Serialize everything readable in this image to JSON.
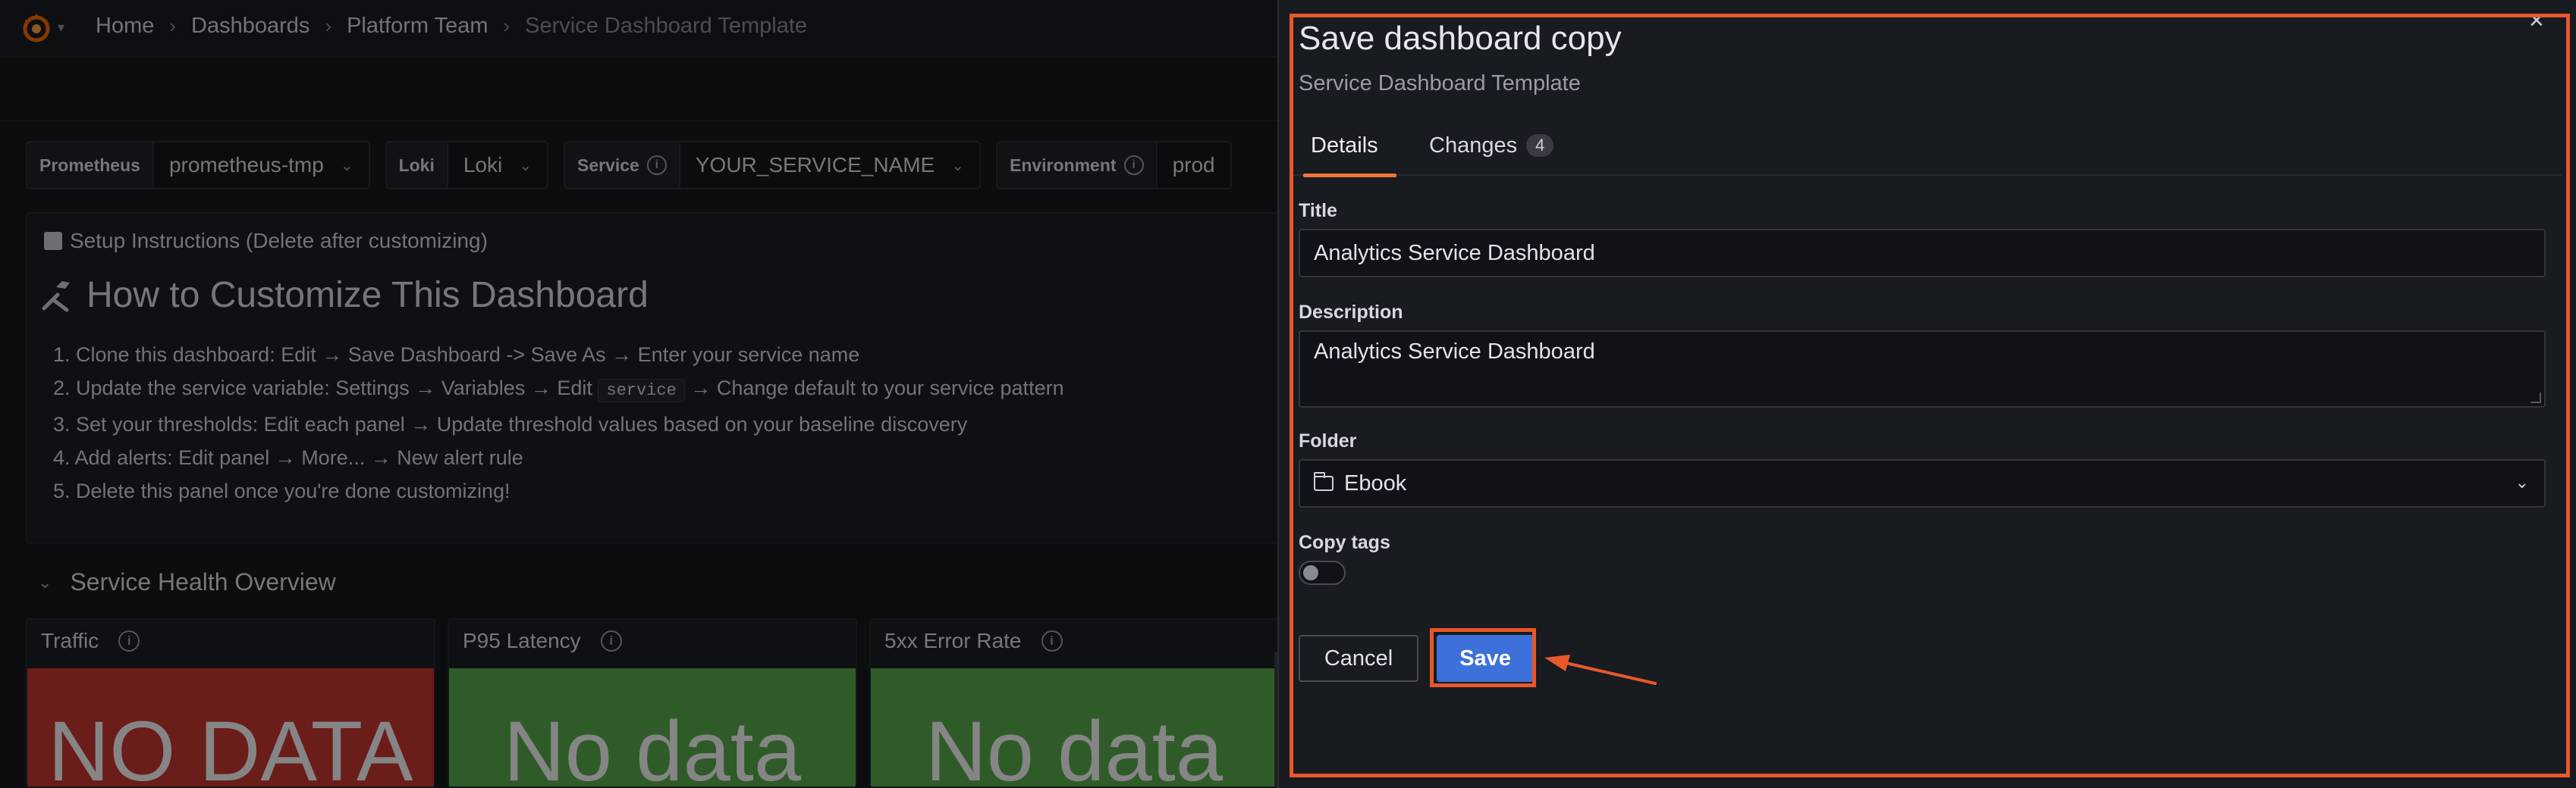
{
  "breadcrumb": {
    "items": [
      "Home",
      "Dashboards",
      "Platform Team",
      "Service Dashboard Template"
    ],
    "separator": "›"
  },
  "variables": [
    {
      "label": "Prometheus",
      "value": "prometheus-tmp",
      "has_info": false
    },
    {
      "label": "Loki",
      "value": "Loki",
      "has_info": false
    },
    {
      "label": "Service",
      "value": "YOUR_SERVICE_NAME",
      "has_info": true
    },
    {
      "label": "Environment",
      "value": "prod",
      "has_info": true
    }
  ],
  "setup": {
    "checkbox_label": "Setup Instructions (Delete after customizing)",
    "title": "How to Customize This Dashboard",
    "steps": [
      {
        "before": "1. Clone this dashboard: Edit → Save Dashboard -> Save As → Enter your service name"
      },
      {
        "before": "2. Update the service variable: Settings → Variables → Edit",
        "code": "service",
        "after": "→ Change default to your service pattern"
      },
      {
        "before": "3. Set your thresholds: Edit each panel → Update threshold values based on your baseline discovery"
      },
      {
        "before": "4. Add alerts: Edit panel → More... → New alert rule"
      },
      {
        "before": "5. Delete this panel once you're done customizing!"
      }
    ]
  },
  "row": {
    "title": "Service Health Overview"
  },
  "panels": [
    {
      "title": "Traffic",
      "value": "NO DATA",
      "color": "#c4362f"
    },
    {
      "title": "P95 Latency",
      "value": "No data",
      "color": "#56a64b"
    },
    {
      "title": "5xx Error Rate",
      "value": "No data",
      "color": "#56a64b"
    }
  ],
  "drawer": {
    "title": "Save dashboard copy",
    "subtitle": "Service Dashboard Template",
    "close_icon": "×",
    "tabs": [
      {
        "label": "Details",
        "active": true
      },
      {
        "label": "Changes",
        "badge": "4",
        "active": false
      }
    ],
    "fields": {
      "title_label": "Title",
      "title_value": "Analytics Service Dashboard",
      "description_label": "Description",
      "description_value": "Analytics Service Dashboard",
      "folder_label": "Folder",
      "folder_value": "Ebook",
      "copy_tags_label": "Copy tags",
      "copy_tags_on": false
    },
    "buttons": {
      "cancel": "Cancel",
      "save": "Save"
    }
  },
  "colors": {
    "accent_highlight": "#e8582b",
    "primary_button": "#3d71d9",
    "active_tab": "#f0773c"
  }
}
